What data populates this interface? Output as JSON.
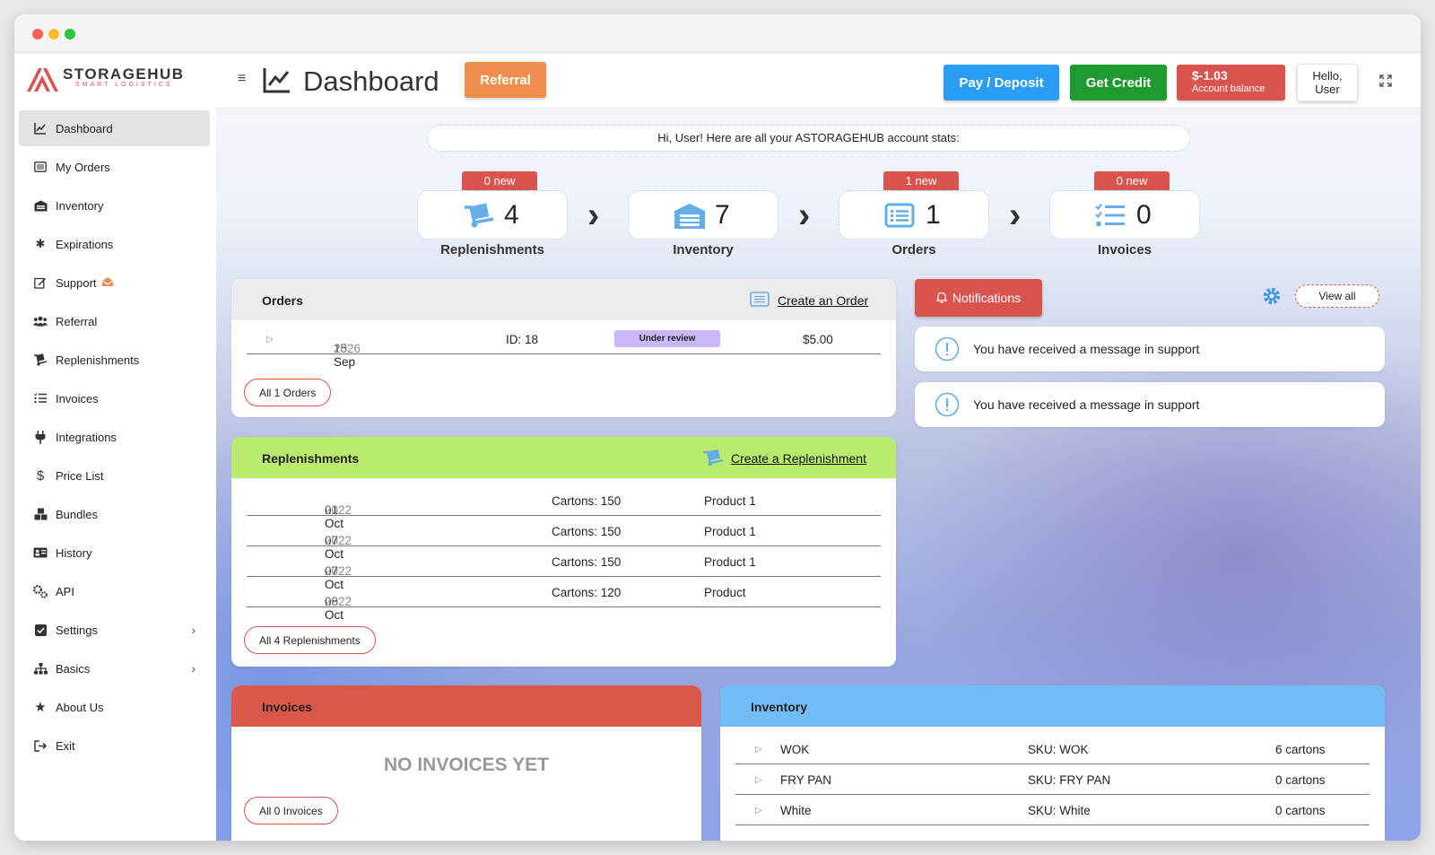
{
  "brand": {
    "name": "STORAGEHUB",
    "tagline": "SMART LOGISTICS",
    "accent": "#d9534f"
  },
  "sidebar": {
    "items": [
      {
        "label": "Dashboard",
        "icon": "chart-line-icon",
        "active": true
      },
      {
        "label": "My Orders",
        "icon": "list-icon"
      },
      {
        "label": "Inventory",
        "icon": "warehouse-icon"
      },
      {
        "label": "Expirations",
        "icon": "asterisk-icon"
      },
      {
        "label": "Support",
        "icon": "edit-icon",
        "badge": "envelope-open-icon"
      },
      {
        "label": "Referral",
        "icon": "users-icon"
      },
      {
        "label": "Replenishments",
        "icon": "dolly-icon"
      },
      {
        "label": "Invoices",
        "icon": "list-check-icon"
      },
      {
        "label": "Integrations",
        "icon": "plug-icon"
      },
      {
        "label": "Price List",
        "icon": "dollar-icon"
      },
      {
        "label": "Bundles",
        "icon": "boxes-icon"
      },
      {
        "label": "History",
        "icon": "id-card-icon"
      },
      {
        "label": "API",
        "icon": "cogs-icon"
      },
      {
        "label": "Settings",
        "icon": "checkbox-icon",
        "expandable": true
      },
      {
        "label": "Basics",
        "icon": "sitemap-icon",
        "expandable": true
      },
      {
        "label": "About Us",
        "icon": "star-icon"
      },
      {
        "label": "Exit",
        "icon": "sign-out-icon"
      }
    ]
  },
  "header": {
    "title": "Dashboard",
    "referral_label": "Referral",
    "pay_label": "Pay / Deposit",
    "credit_label": "Get Credit",
    "balance_value": "$-1.03",
    "balance_label": "Account balance",
    "hello_line1": "Hello,",
    "hello_line2": "User"
  },
  "welcome": "Hi, User! Here are all your ASTORAGEHUB account stats:",
  "stats": [
    {
      "label": "Replenishments",
      "value": "4",
      "badge": "0 new",
      "icon": "dolly-icon"
    },
    {
      "label": "Inventory",
      "value": "7",
      "badge": "",
      "icon": "warehouse-icon"
    },
    {
      "label": "Orders",
      "value": "1",
      "badge": "1 new",
      "icon": "list-icon"
    },
    {
      "label": "Invoices",
      "value": "0",
      "badge": "0 new",
      "icon": "list-check-icon"
    }
  ],
  "orders": {
    "title": "Orders",
    "create_label": "Create an Order",
    "rows": [
      {
        "day": "15 Sep",
        "year": "2026",
        "id": "ID: 18",
        "status": "Under review",
        "amount": "$5.00"
      }
    ],
    "all_label": "All 1 Orders",
    "header_color": "#ececec"
  },
  "replenishments": {
    "title": "Replenishments",
    "create_label": "Create a Replenishment",
    "rows": [
      {
        "day": "01 Oct",
        "year": "2022",
        "cartons": "Cartons: 150",
        "product": "Product 1"
      },
      {
        "day": "07 Oct",
        "year": "2022",
        "cartons": "Cartons: 150",
        "product": "Product 1"
      },
      {
        "day": "07 Oct",
        "year": "2022",
        "cartons": "Cartons: 150",
        "product": "Product 1"
      },
      {
        "day": "08 Oct",
        "year": "2022",
        "cartons": "Cartons: 120",
        "product": "Product"
      }
    ],
    "all_label": "All 4 Replenishments",
    "header_color": "#b8eb6e"
  },
  "notifications": {
    "button_label": "Notifications",
    "view_all_label": "View all",
    "items": [
      {
        "text": "You have received a message in support"
      },
      {
        "text": "You have received a message in support"
      }
    ]
  },
  "invoices": {
    "title": "Invoices",
    "empty_label": "NO INVOICES YET",
    "all_label": "All 0 Invoices",
    "header_color": "#d9584a"
  },
  "inventory": {
    "title": "Inventory",
    "rows": [
      {
        "name": "WOK",
        "sku": "SKU: WOK",
        "qty": "6 cartons"
      },
      {
        "name": "FRY PAN",
        "sku": "SKU: FRY PAN",
        "qty": "0 cartons"
      },
      {
        "name": "White",
        "sku": "SKU: White",
        "qty": "0 cartons"
      }
    ],
    "header_color": "#72bdf8"
  }
}
